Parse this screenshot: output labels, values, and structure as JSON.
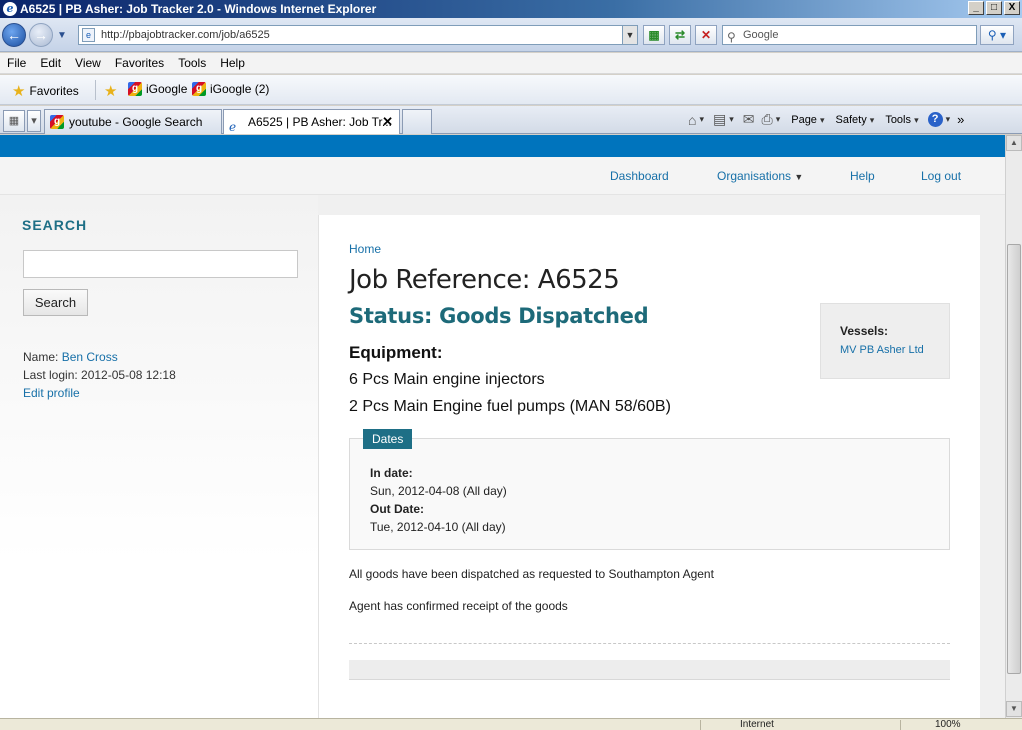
{
  "window": {
    "title": "A6525 | PB Asher: Job Tracker 2.0 - Windows Internet Explorer",
    "min": "_",
    "max": "□",
    "close": "X"
  },
  "toolbar": {
    "url": "http://pbajobtracker.com/job/a6525",
    "search_placeholder": "Google"
  },
  "menu": [
    "File",
    "Edit",
    "View",
    "Favorites",
    "Tools",
    "Help"
  ],
  "favorites": {
    "label": "Favorites",
    "items": [
      "iGoogle",
      "iGoogle (2)"
    ]
  },
  "tabs": [
    {
      "label": "youtube - Google Search",
      "active": false
    },
    {
      "label": "A6525 | PB Asher: Job Tr...",
      "active": true
    }
  ],
  "commandbar": {
    "page": "Page",
    "safety": "Safety",
    "tools": "Tools"
  },
  "site_nav": {
    "items": [
      "Dashboard",
      "Organisations",
      "Help",
      "Log out"
    ]
  },
  "sidebar": {
    "title": "SEARCH",
    "search_button": "Search",
    "name_label": "Name:",
    "name_value": "Ben Cross",
    "last_login": "Last login: 2012-05-08 12:18",
    "edit_profile": "Edit profile"
  },
  "job": {
    "breadcrumb": "Home",
    "reference": "Job Reference: A6525",
    "status": "Status: Goods Dispatched",
    "equipment_label": "Equipment:",
    "equipment": [
      "6 Pcs Main engine injectors",
      "2 Pcs Main Engine fuel pumps (MAN 58/60B)"
    ],
    "vessels_label": "Vessels:",
    "vessel": "MV PB Asher Ltd",
    "dates_title": "Dates",
    "in_date_label": "In date:",
    "in_date": "Sun, 2012-04-08 (All day)",
    "out_date_label": "Out Date:",
    "out_date": "Tue, 2012-04-10 (All day)",
    "notes": [
      "All goods have been dispatched as requested to Southampton Agent",
      "Agent has confirmed receipt of the goods"
    ]
  },
  "statusbar": {
    "zone": "Internet",
    "zoom": "100%"
  },
  "colors": {
    "header_band": "#0074bd",
    "accent_teal": "#1e6f86",
    "link": "#1770a8"
  }
}
